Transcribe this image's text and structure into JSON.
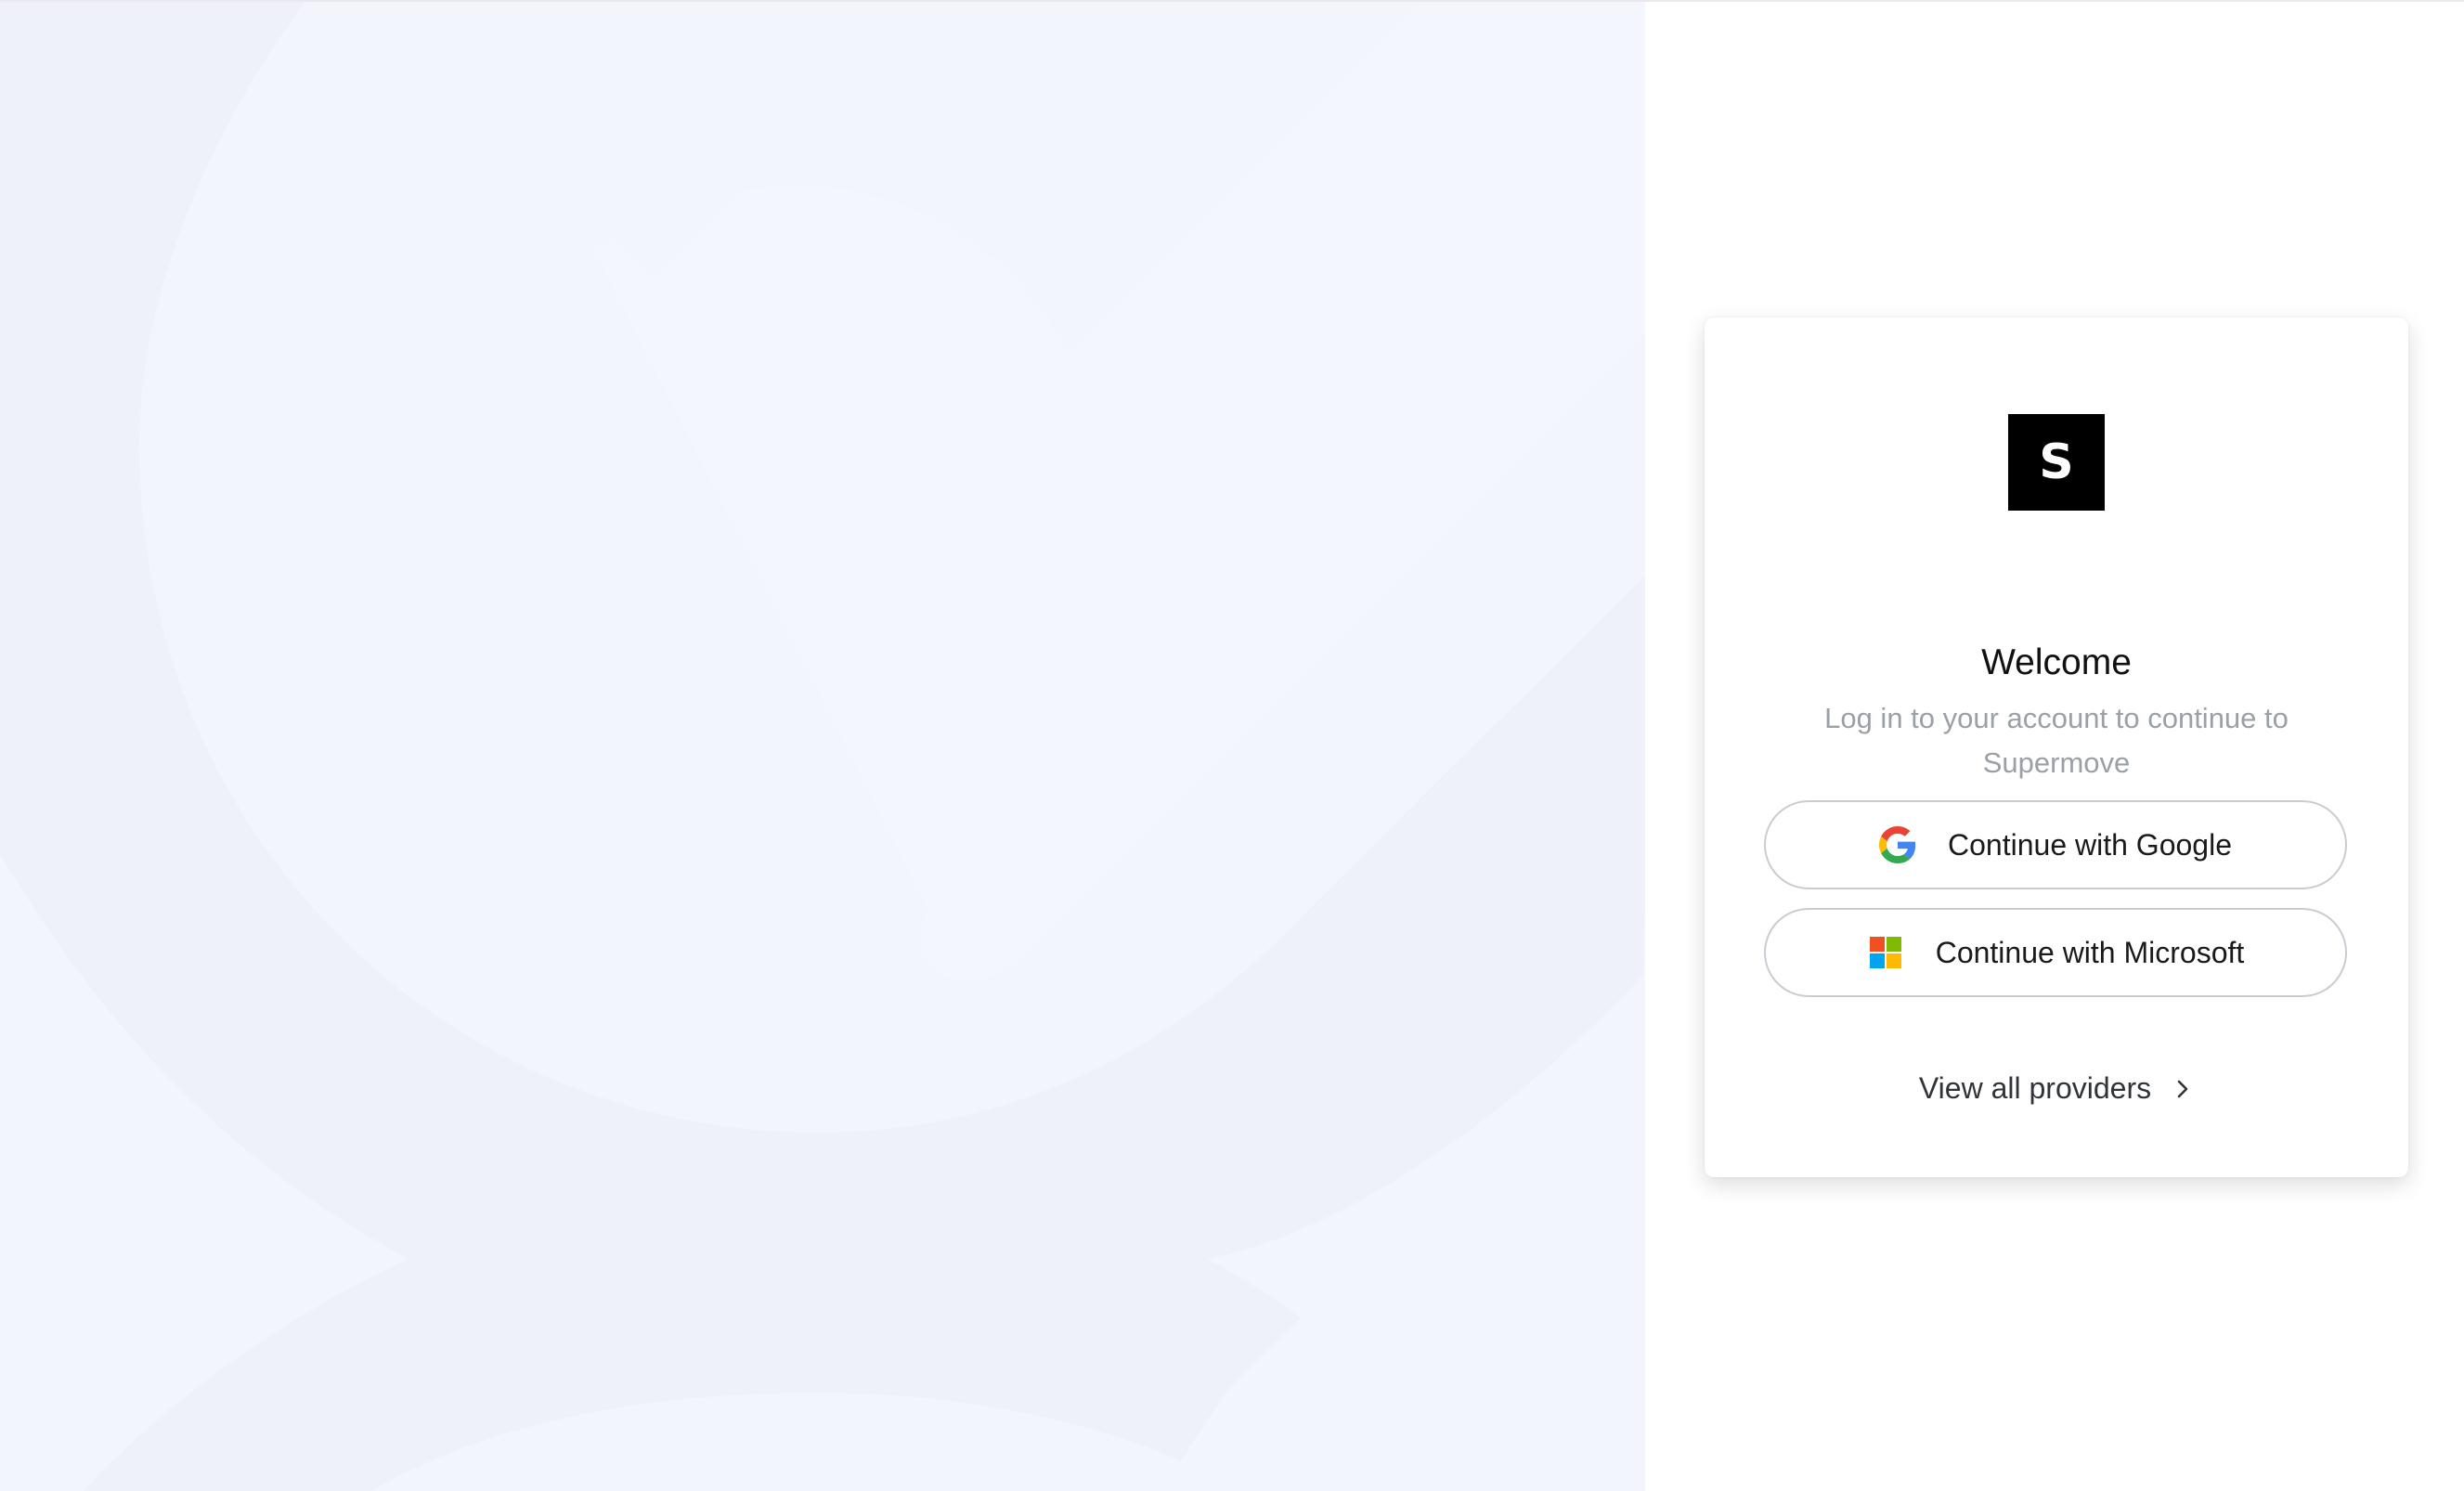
{
  "colors": {
    "background_panel": "#f2f5fc",
    "background_pattern": "#edf0fa",
    "card": "#ffffff",
    "logo_bg": "#000000",
    "subtitle_text": "#9aa0a6",
    "button_border": "#c9cdd2"
  },
  "background": {
    "decoration_icon": "abstract-shapes-pattern"
  },
  "login_card": {
    "logo": {
      "letter": "S",
      "icon": "brand-logo"
    },
    "title": "Welcome",
    "subtitle": "Log in to your account to continue to Supermove",
    "providers": [
      {
        "label": "Continue with Google",
        "icon": "google-icon"
      },
      {
        "label": "Continue with Microsoft",
        "icon": "microsoft-icon"
      }
    ],
    "view_all": {
      "label": "View all providers",
      "icon": "chevron-right-icon"
    }
  }
}
